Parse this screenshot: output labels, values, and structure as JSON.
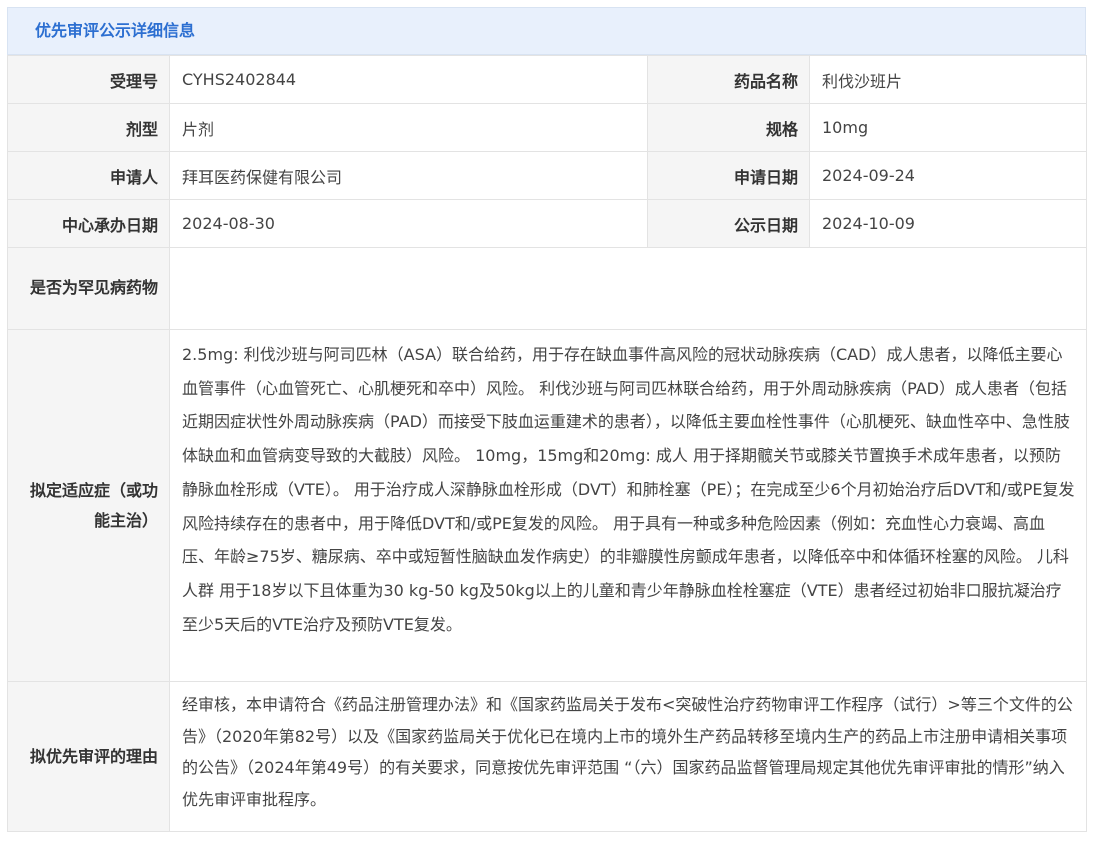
{
  "panel": {
    "title": "优先审评公示详细信息"
  },
  "fields": {
    "accept_no_label": "受理号",
    "accept_no": "CYHS2402844",
    "drug_name_label": "药品名称",
    "drug_name": "利伐沙班片",
    "dosage_form_label": "剂型",
    "dosage_form": "片剂",
    "spec_label": "规格",
    "spec": "10mg",
    "applicant_label": "申请人",
    "applicant": "拜耳医药保健有限公司",
    "apply_date_label": "申请日期",
    "apply_date": "2024-09-24",
    "center_date_label": "中心承办日期",
    "center_date": "2024-08-30",
    "publish_date_label": "公示日期",
    "publish_date": "2024-10-09",
    "rare_disease_label": "是否为罕见病药物",
    "rare_disease": "",
    "indication_label": "拟定适应症（或功能主治）",
    "indication": "2.5mg: 利伐沙班与阿司匹林（ASA）联合给药，用于存在缺血事件高风险的冠状动脉疾病（CAD）成人患者，以降低主要心血管事件（心血管死亡、心肌梗死和卒中）风险。 利伐沙班与阿司匹林联合给药，用于外周动脉疾病（PAD）成人患者（包括近期因症状性外周动脉疾病（PAD）而接受下肢血运重建术的患者），以降低主要血栓性事件（心肌梗死、缺血性卒中、急性肢体缺血和血管病变导致的大截肢）风险。 10mg，15mg和20mg: 成人 用于择期髋关节或膝关节置换手术成年患者，以预防静脉血栓形成（VTE）。 用于治疗成人深静脉血栓形成（DVT）和肺栓塞（PE）；在完成至少6个月初始治疗后DVT和/或PE复发风险持续存在的患者中，用于降低DVT和/或PE复发的风险。 用于具有一种或多种危险因素（例如：充血性心力衰竭、高血压、年龄≥75岁、糖尿病、卒中或短暂性脑缺血发作病史）的非瓣膜性房颤成年患者，以降低卒中和体循环栓塞的风险。 儿科人群 用于18岁以下且体重为30 kg-50 kg及50kg以上的儿童和青少年静脉血栓栓塞症（VTE）患者经过初始非口服抗凝治疗至少5天后的VTE治疗及预防VTE复发。",
    "reason_label": "拟优先审评的理由",
    "reason": "经审核，本申请符合《药品注册管理办法》和《国家药监局关于发布<突破性治疗药物审评工作程序（试行）>等三个文件的公告》（2020年第82号）以及《国家药监局关于优化已在境内上市的境外生产药品转移至境内生产的药品上市注册申请相关事项的公告》（2024年第49号）的有关要求，同意按优先审评范围 “（六）国家药品监督管理局规定其他优先审评审批的情形”纳入优先审评审批程序。"
  }
}
